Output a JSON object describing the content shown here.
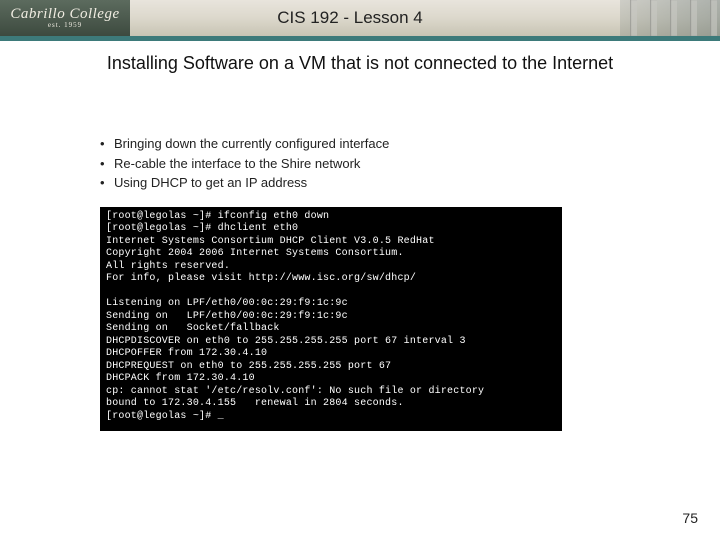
{
  "header": {
    "logo_main": "Cabrillo College",
    "logo_sub": "est. 1959",
    "title": "CIS 192 - Lesson 4"
  },
  "slide": {
    "title": "Installing Software on a VM that is not connected to the Internet",
    "bullets": [
      "Bringing down the currently configured interface",
      "Re-cable the interface to the Shire network",
      "Using DHCP to get an IP address"
    ]
  },
  "terminal": {
    "lines": [
      "[root@legolas ~]# ifconfig eth0 down",
      "[root@legolas ~]# dhclient eth0",
      "Internet Systems Consortium DHCP Client V3.0.5 RedHat",
      "Copyright 2004 2006 Internet Systems Consortium.",
      "All rights reserved.",
      "For info, please visit http://www.isc.org/sw/dhcp/",
      "",
      "Listening on LPF/eth0/00:0c:29:f9:1c:9c",
      "Sending on   LPF/eth0/00:0c:29:f9:1c:9c",
      "Sending on   Socket/fallback",
      "DHCPDISCOVER on eth0 to 255.255.255.255 port 67 interval 3",
      "DHCPOFFER from 172.30.4.10",
      "DHCPREQUEST on eth0 to 255.255.255.255 port 67",
      "DHCPACK from 172.30.4.10",
      "cp: cannot stat '/etc/resolv.conf': No such file or directory",
      "bound to 172.30.4.155   renewal in 2804 seconds.",
      "[root@legolas ~]# _"
    ]
  },
  "page_number": "75"
}
